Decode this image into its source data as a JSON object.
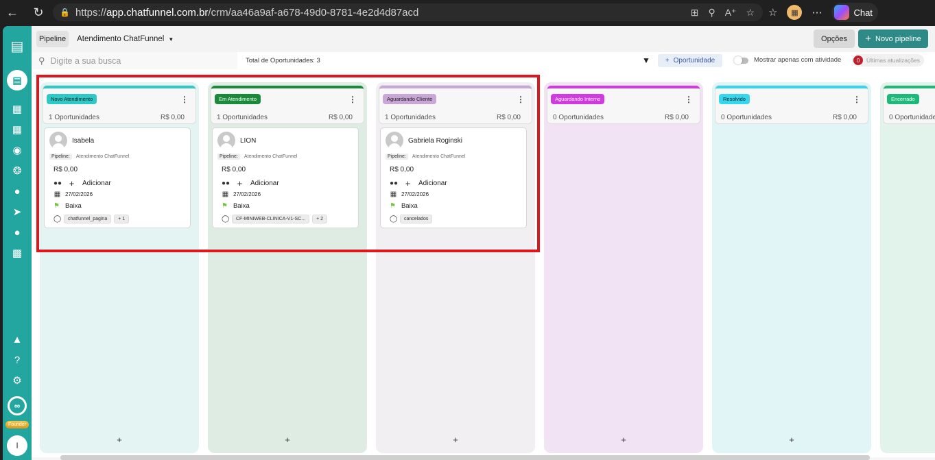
{
  "browser": {
    "url_scheme": "https://",
    "url_host": "app.chatfunnel.com.br",
    "url_path": "/crm/aa46a9af-a678-49d0-8781-4e2d4d87acd",
    "copilot_label": "Chat"
  },
  "topbar": {
    "pipeline_tab": "Pipeline",
    "pipeline_name": "Atendimento ChatFunnel",
    "options_button": "Opções",
    "new_pipeline_button": "Novo pipeline"
  },
  "toolbar": {
    "search_placeholder": "Digite a sua busca",
    "total": "Total de Oportunidades: 3",
    "opportunity_button": "Oportunidade",
    "activity_toggle_label": "Mostrar apenas com atividade",
    "updates_count": "0",
    "updates_label": "Últimas atualizações"
  },
  "sidebar": {
    "founder_label": "Founder",
    "avatar_initial": "I"
  },
  "columns": [
    {
      "title": "Novo Atendimento",
      "count": "1 Oportunidades",
      "value": "R$ 0,00",
      "color": "#2ec9c6",
      "badge_text": "#1b1b1b",
      "bg": "#e3f4f3",
      "add": "+"
    },
    {
      "title": "Em Atendimento",
      "count": "1 Oportunidades",
      "value": "R$ 0,00",
      "color": "#1a8a3a",
      "badge_text": "#ffffff",
      "bg": "#dfece3",
      "add": "+"
    },
    {
      "title": "Aguardando Cliente",
      "count": "1 Oportunidades",
      "value": "R$ 0,00",
      "color": "#c8a6d6",
      "badge_text": "#1b1b1b",
      "bg": "#f1eff2",
      "add": "+"
    },
    {
      "title": "Aguardando Interno",
      "count": "0 Oportunidades",
      "value": "R$ 0,00",
      "color": "#d13ae0",
      "badge_text": "#ffffff",
      "bg": "#f1e3f3",
      "add": "+"
    },
    {
      "title": "Resolvido",
      "count": "0 Oportunidades",
      "value": "R$ 0,00",
      "color": "#35d6ee",
      "badge_text": "#1b1b1b",
      "bg": "#e2f5f6",
      "add": "+"
    },
    {
      "title": "Encerrado",
      "count": "0 Oportunidades",
      "value": "R$ 0,00",
      "color": "#1db87a",
      "badge_text": "#ffffff",
      "bg": "#e2f3ec",
      "add": "+"
    }
  ],
  "cards": [
    {
      "name": "Isabela",
      "pipeline_key": "Pipeline:",
      "pipeline_value": "Atendimento ChatFunnel",
      "value": "R$ 0,00",
      "add_label": "Adicionar",
      "date": "27/02/2026",
      "priority": "Baixa",
      "tag": "chatfunnel_pagina",
      "more": "+ 1"
    },
    {
      "name": "LION",
      "pipeline_key": "Pipeline:",
      "pipeline_value": "Atendimento ChatFunnel",
      "value": "R$ 0,00",
      "add_label": "Adicionar",
      "date": "27/02/2026",
      "priority": "Baixa",
      "tag": "CF-MINIWEB-CLINICA-V1-SC...",
      "more": "+ 2"
    },
    {
      "name": "Gabriela Roginski",
      "pipeline_key": "Pipeline:",
      "pipeline_value": "Atendimento ChatFunnel",
      "value": "R$ 0,00",
      "add_label": "Adicionar",
      "date": "27/02/2026",
      "priority": "Baixa",
      "tag": "cancelados",
      "more": ""
    }
  ]
}
